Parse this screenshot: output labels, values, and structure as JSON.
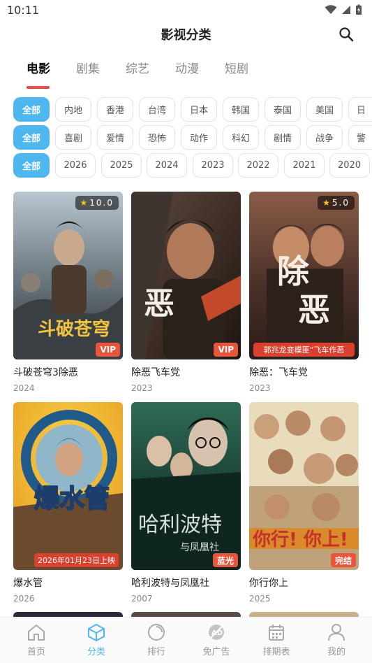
{
  "status_bar": {
    "time": "10:11"
  },
  "header": {
    "title": "影视分类"
  },
  "type_tabs": [
    {
      "label": "电影",
      "active": true
    },
    {
      "label": "剧集"
    },
    {
      "label": "综艺"
    },
    {
      "label": "动漫"
    },
    {
      "label": "短剧"
    }
  ],
  "filters": {
    "region": [
      "全部",
      "内地",
      "香港",
      "台湾",
      "日本",
      "韩国",
      "泰国",
      "美国",
      "日"
    ],
    "genre": [
      "全部",
      "喜剧",
      "爱情",
      "恐怖",
      "动作",
      "科幻",
      "剧情",
      "战争",
      "警"
    ],
    "year": [
      "全部",
      "2026",
      "2025",
      "2024",
      "2023",
      "2022",
      "2021",
      "2020"
    ]
  },
  "movies": [
    {
      "title": "斗破苍穹3除恶",
      "year": "2024",
      "rating": "10.0",
      "badge": "VIP"
    },
    {
      "title": "除恶飞车党",
      "year": "2023",
      "badge": "VIP"
    },
    {
      "title": "除恶：飞车党",
      "year": "2023",
      "rating": "5.0",
      "ribbon": "郭兆龙变模匪“飞车作恶"
    },
    {
      "title": "爆水管",
      "year": "2026",
      "ribbon": "2026年01月23日上映"
    },
    {
      "title": "哈利波特与凤凰社",
      "year": "2007",
      "badge": "蓝光"
    },
    {
      "title": "你行你上",
      "year": "2025",
      "badge": "完结"
    }
  ],
  "bottom_nav": [
    {
      "label": "首页",
      "icon": "home-icon"
    },
    {
      "label": "分类",
      "icon": "cube-icon",
      "active": true
    },
    {
      "label": "排行",
      "icon": "ranking-icon"
    },
    {
      "label": "免广告",
      "icon": "no-ads-icon"
    },
    {
      "label": "排期表",
      "icon": "calendar-icon"
    },
    {
      "label": "我的",
      "icon": "profile-icon"
    }
  ],
  "colors": {
    "accent": "#4fb7ef",
    "tab_underline": "#f04a3e",
    "badge": "#e8553b"
  }
}
